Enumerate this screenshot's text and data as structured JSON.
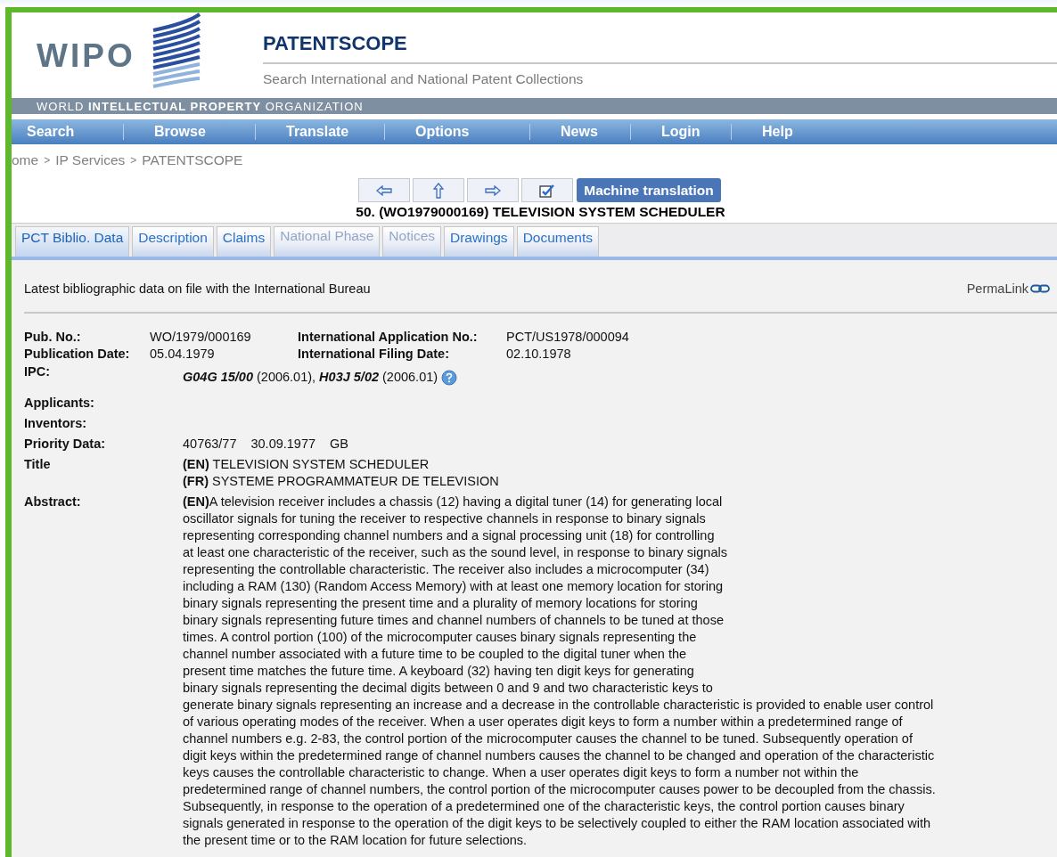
{
  "header": {
    "logo_text": "WIPO",
    "site_title": "PATENTSCOPE",
    "subtitle": "Search International and National Patent Collections",
    "org_band": "WORLD **INTELLECTUAL PROPERTY** ORGANIZATION"
  },
  "nav": [
    "Search",
    "Browse",
    "Translate",
    "Options",
    "News",
    "Login",
    "Help"
  ],
  "breadcrumb": {
    "items": [
      "ome",
      "IP Services",
      "PATENTSCOPE"
    ],
    "separator": ">"
  },
  "toolbar": [
    {
      "kind": "prev"
    },
    {
      "kind": "up"
    },
    {
      "kind": "next"
    },
    {
      "kind": "edit"
    },
    {
      "kind": "text",
      "label": "Machine translation"
    }
  ],
  "document_title": "50. (WO1979000169) TELEVISION SYSTEM SCHEDULER",
  "tabs": [
    {
      "label": "PCT Biblio. Data",
      "selected": true,
      "disabled": false
    },
    {
      "label": "Description",
      "selected": false,
      "disabled": false
    },
    {
      "label": "Claims",
      "selected": false,
      "disabled": false
    },
    {
      "label": "National Phase",
      "selected": false,
      "disabled": true
    },
    {
      "label": "Notices",
      "selected": false,
      "disabled": true
    },
    {
      "label": "Drawings",
      "selected": false,
      "disabled": false
    },
    {
      "label": "Documents",
      "selected": false,
      "disabled": false
    }
  ],
  "content": {
    "intro": "Latest bibliographic data on file with the International Bureau",
    "permalink": "PermaLink",
    "pub_no": {
      "label": "Pub. No.:",
      "value": "WO/1979/000169"
    },
    "app_no": {
      "label": "International Application No.:",
      "value": "PCT/US1978/000094"
    },
    "pub_date": {
      "label": "Publication Date:",
      "value": "05.04.1979"
    },
    "filing_date": {
      "label": "International Filing Date:",
      "value": "02.10.1978"
    },
    "ipc": {
      "label": "IPC:",
      "items": [
        {
          "code": "G04G 15/00",
          "version": "(2006.01),"
        },
        {
          "code": "H03J 5/02",
          "version": "(2006.01)"
        }
      ]
    },
    "applicants": {
      "label": "Applicants:"
    },
    "inventors": {
      "label": "Inventors:"
    },
    "priority": {
      "label": "Priority Data:",
      "values": [
        "40763/77",
        "30.09.1977",
        "GB"
      ]
    },
    "title": {
      "label": "Title",
      "lines": [
        {
          "lang": "(EN)",
          "text": "TELEVISION SYSTEM SCHEDULER"
        },
        {
          "lang": "(FR)",
          "text": "SYSTEME PROGRAMMATEUR DE TELEVISION"
        }
      ]
    },
    "abstract": {
      "label": "Abstract:",
      "lines": [
        "**(EN)**A television receiver includes a chassis (12) having a digital tuner (14) for generating local",
        "oscillator signals for tuning the receiver to respective channels in response to binary signals",
        "representing corresponding channel numbers and a signal processing unit (18) for controlling",
        "at least one characteristic of the receiver, such as the sound level, in response to binary signals",
        "representing the controllable characteristic. The receiver also includes a microcomputer (34)",
        "including a RAM (130) (Random Access Memory) with at least one memory location for storing",
        "binary signals representing the present time and a plurality of memory locations for storing",
        "binary signals representing future times and channel numbers of channels to be tuned at those",
        "times. A control portion (100) of the microcomputer causes binary signals representing the",
        "channel number associated with a future time to be coupled to the digital tuner when the",
        "present time matches the future time. A keyboard (32) having ten digit keys for generating",
        "binary signals representing the decimal digits between 0 and 9 and two characteristic keys to",
        "generate binary signals representing an increase and a decrease in the controllable characteristic is provided to enable user control",
        "of various operating modes of the receiver. When a user operates digit keys to form a number within a predetermined range of",
        "channel numbers e.g. 2-83, the control portion of the microcomputer causes the channel to be tuned. Subsequently operation of",
        "digit keys within the predetermined range of channel numbers causes the channel to be changed and operation of the characteristic",
        "keys causes the controllable characteristic to change. When a user operates digit keys to form a number not within the",
        "predetermined range of channel numbers, the control portion of the microcomputer causes power to be decoupled from the chassis.",
        "Subsequently, in response to the operation of a predetermined one of the characteristic keys, the control portion causes binary",
        "signals generated in response to the operation of the digit keys to be selectively coupled to either the RAM location associated with",
        "the present time or to the RAM location for future selections."
      ]
    }
  }
}
